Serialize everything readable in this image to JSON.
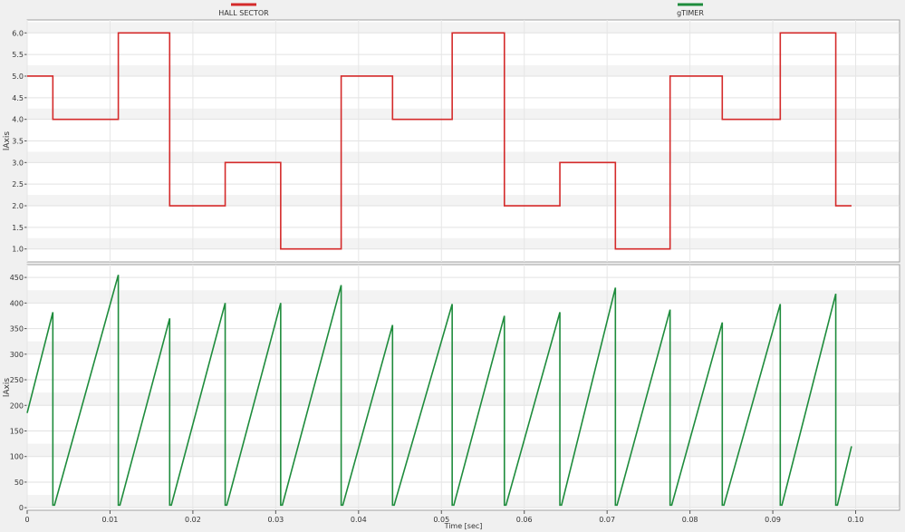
{
  "chart_data": [
    {
      "type": "line",
      "step": true,
      "ylabel": "lAxis",
      "xlabel": "",
      "ylim": [
        0.7,
        6.3
      ],
      "yticks": [
        "1.0",
        "1.5",
        "2.0",
        "2.5",
        "3.0",
        "3.5",
        "4.0",
        "4.5",
        "5.0",
        "5.5",
        "6.0"
      ],
      "series": [
        {
          "name": "HALL SECTOR",
          "color": "#d42a2a",
          "x": [
            0,
            0.0031,
            0.011,
            0.0172,
            0.0239,
            0.0306,
            0.0379,
            0.0441,
            0.0513,
            0.0576,
            0.0643,
            0.071,
            0.0776,
            0.0839,
            0.0909,
            0.0976,
            0.0995
          ],
          "values": [
            5,
            4,
            6,
            2,
            3,
            1,
            5,
            4,
            6,
            2,
            3,
            1,
            5,
            4,
            6,
            2,
            2
          ]
        }
      ]
    },
    {
      "type": "line",
      "ylabel": "lAxis",
      "xlabel": "Time [sec]",
      "xlim": [
        0,
        0.1053
      ],
      "ylim": [
        -5,
        475
      ],
      "yticks": [
        "0",
        "50",
        "100",
        "150",
        "200",
        "250",
        "300",
        "350",
        "400",
        "450"
      ],
      "xticks": [
        "0",
        "0.01",
        "0.02",
        "0.03",
        "0.04",
        "0.05",
        "0.06",
        "0.07",
        "0.08",
        "0.09",
        "0.10"
      ],
      "series": [
        {
          "name": "gTIMER",
          "color": "#1e8c3c",
          "x": [
            0,
            0.0031,
            0.0031,
            0.0033,
            0.011,
            0.011,
            0.0112,
            0.0172,
            0.0172,
            0.0174,
            0.0239,
            0.0239,
            0.0241,
            0.0306,
            0.0306,
            0.0308,
            0.0379,
            0.0379,
            0.0381,
            0.0441,
            0.0441,
            0.0443,
            0.0513,
            0.0513,
            0.0515,
            0.0576,
            0.0576,
            0.0578,
            0.0643,
            0.0643,
            0.0645,
            0.071,
            0.071,
            0.0712,
            0.0776,
            0.0776,
            0.0778,
            0.0839,
            0.0839,
            0.0841,
            0.0909,
            0.0909,
            0.0911,
            0.0976,
            0.0976,
            0.0978,
            0.0995
          ],
          "values": [
            185,
            382,
            5,
            5,
            455,
            5,
            5,
            370,
            5,
            5,
            400,
            5,
            5,
            400,
            5,
            5,
            435,
            5,
            5,
            357,
            5,
            5,
            398,
            5,
            5,
            375,
            5,
            5,
            382,
            5,
            5,
            430,
            5,
            5,
            387,
            5,
            5,
            362,
            5,
            5,
            398,
            5,
            5,
            418,
            5,
            5,
            120
          ]
        }
      ]
    }
  ]
}
